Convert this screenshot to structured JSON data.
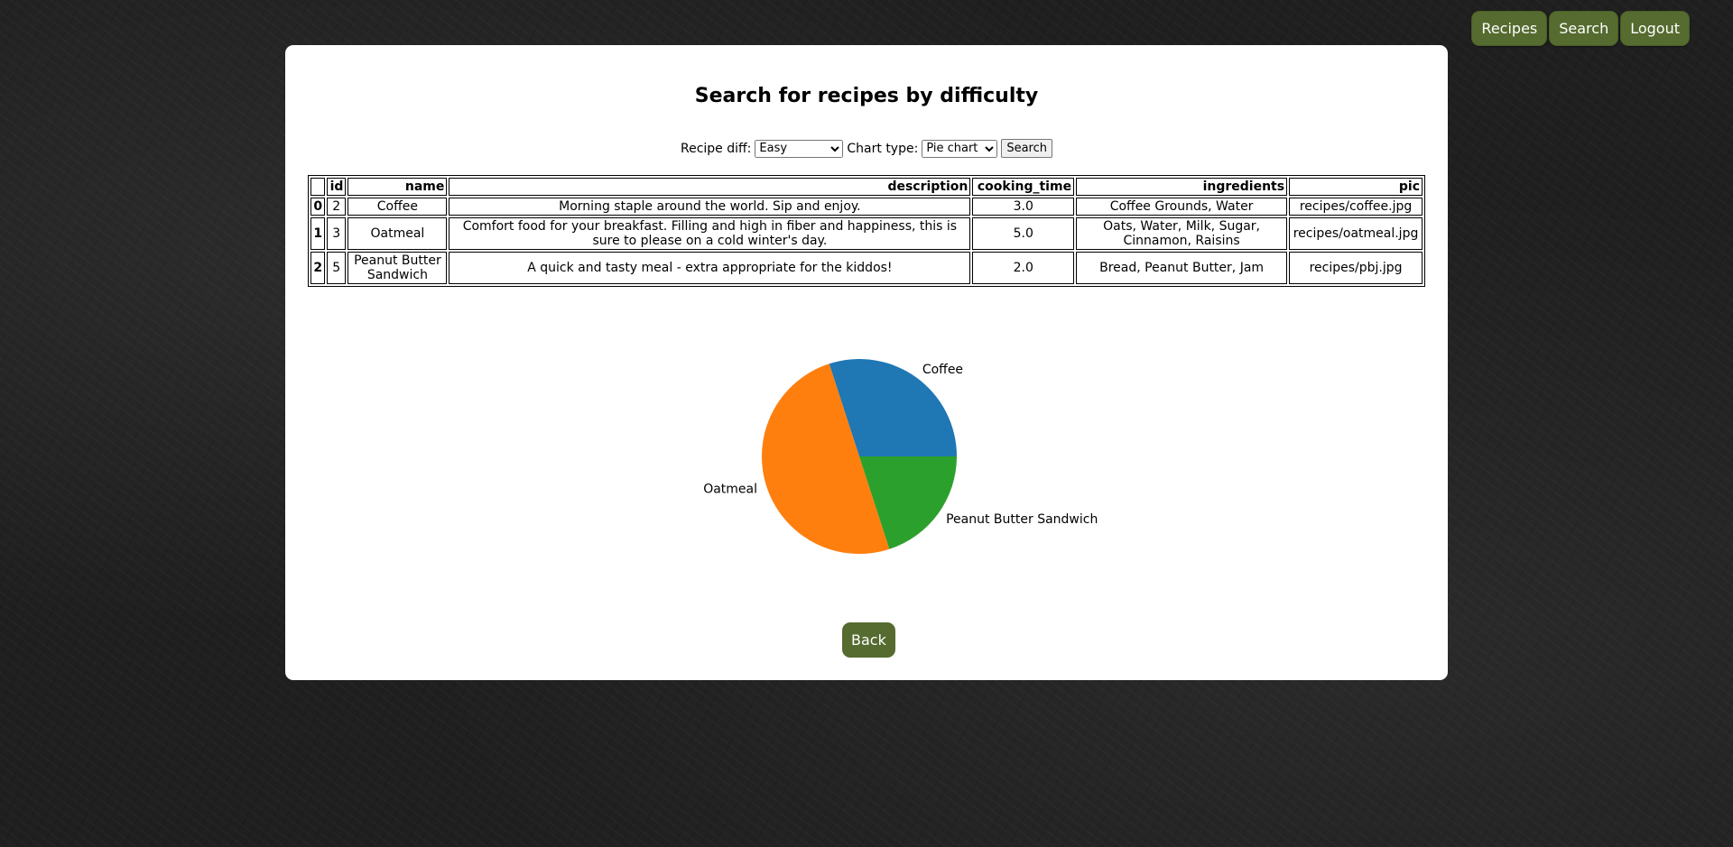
{
  "nav": {
    "recipes": "Recipes",
    "search": "Search",
    "logout": "Logout"
  },
  "page": {
    "title": "Search for recipes by difficulty"
  },
  "form": {
    "diff_label": "Recipe diff:",
    "diff_value": "Easy",
    "chart_label": "Chart type:",
    "chart_value": "Pie chart",
    "search_label": "Search"
  },
  "table": {
    "headers": [
      "",
      "id",
      "name",
      "description",
      "cooking_time",
      "ingredients",
      "pic"
    ],
    "rows": [
      [
        "0",
        "2",
        "Coffee",
        "Morning staple around the world. Sip and enjoy.",
        "3.0",
        "Coffee Grounds, Water",
        "recipes/coffee.jpg"
      ],
      [
        "1",
        "3",
        "Oatmeal",
        "Comfort food for your breakfast. Filling and high in fiber and happiness, this is sure to please on a cold winter's day.",
        "5.0",
        "Oats, Water, Milk, Sugar, Cinnamon, Raisins",
        "recipes/oatmeal.jpg"
      ],
      [
        "2",
        "5",
        "Peanut Butter Sandwich",
        "A quick and tasty meal - extra appropriate for the kiddos!",
        "2.0",
        "Bread, Peanut Butter, Jam",
        "recipes/pbj.jpg"
      ]
    ]
  },
  "chart_data": {
    "type": "pie",
    "categories": [
      "Coffee",
      "Oatmeal",
      "Peanut Butter Sandwich"
    ],
    "values": [
      3.0,
      5.0,
      2.0
    ],
    "colors": [
      "#1f77b4",
      "#ff7f0e",
      "#2ca02c"
    ]
  },
  "back": {
    "label": "Back"
  }
}
